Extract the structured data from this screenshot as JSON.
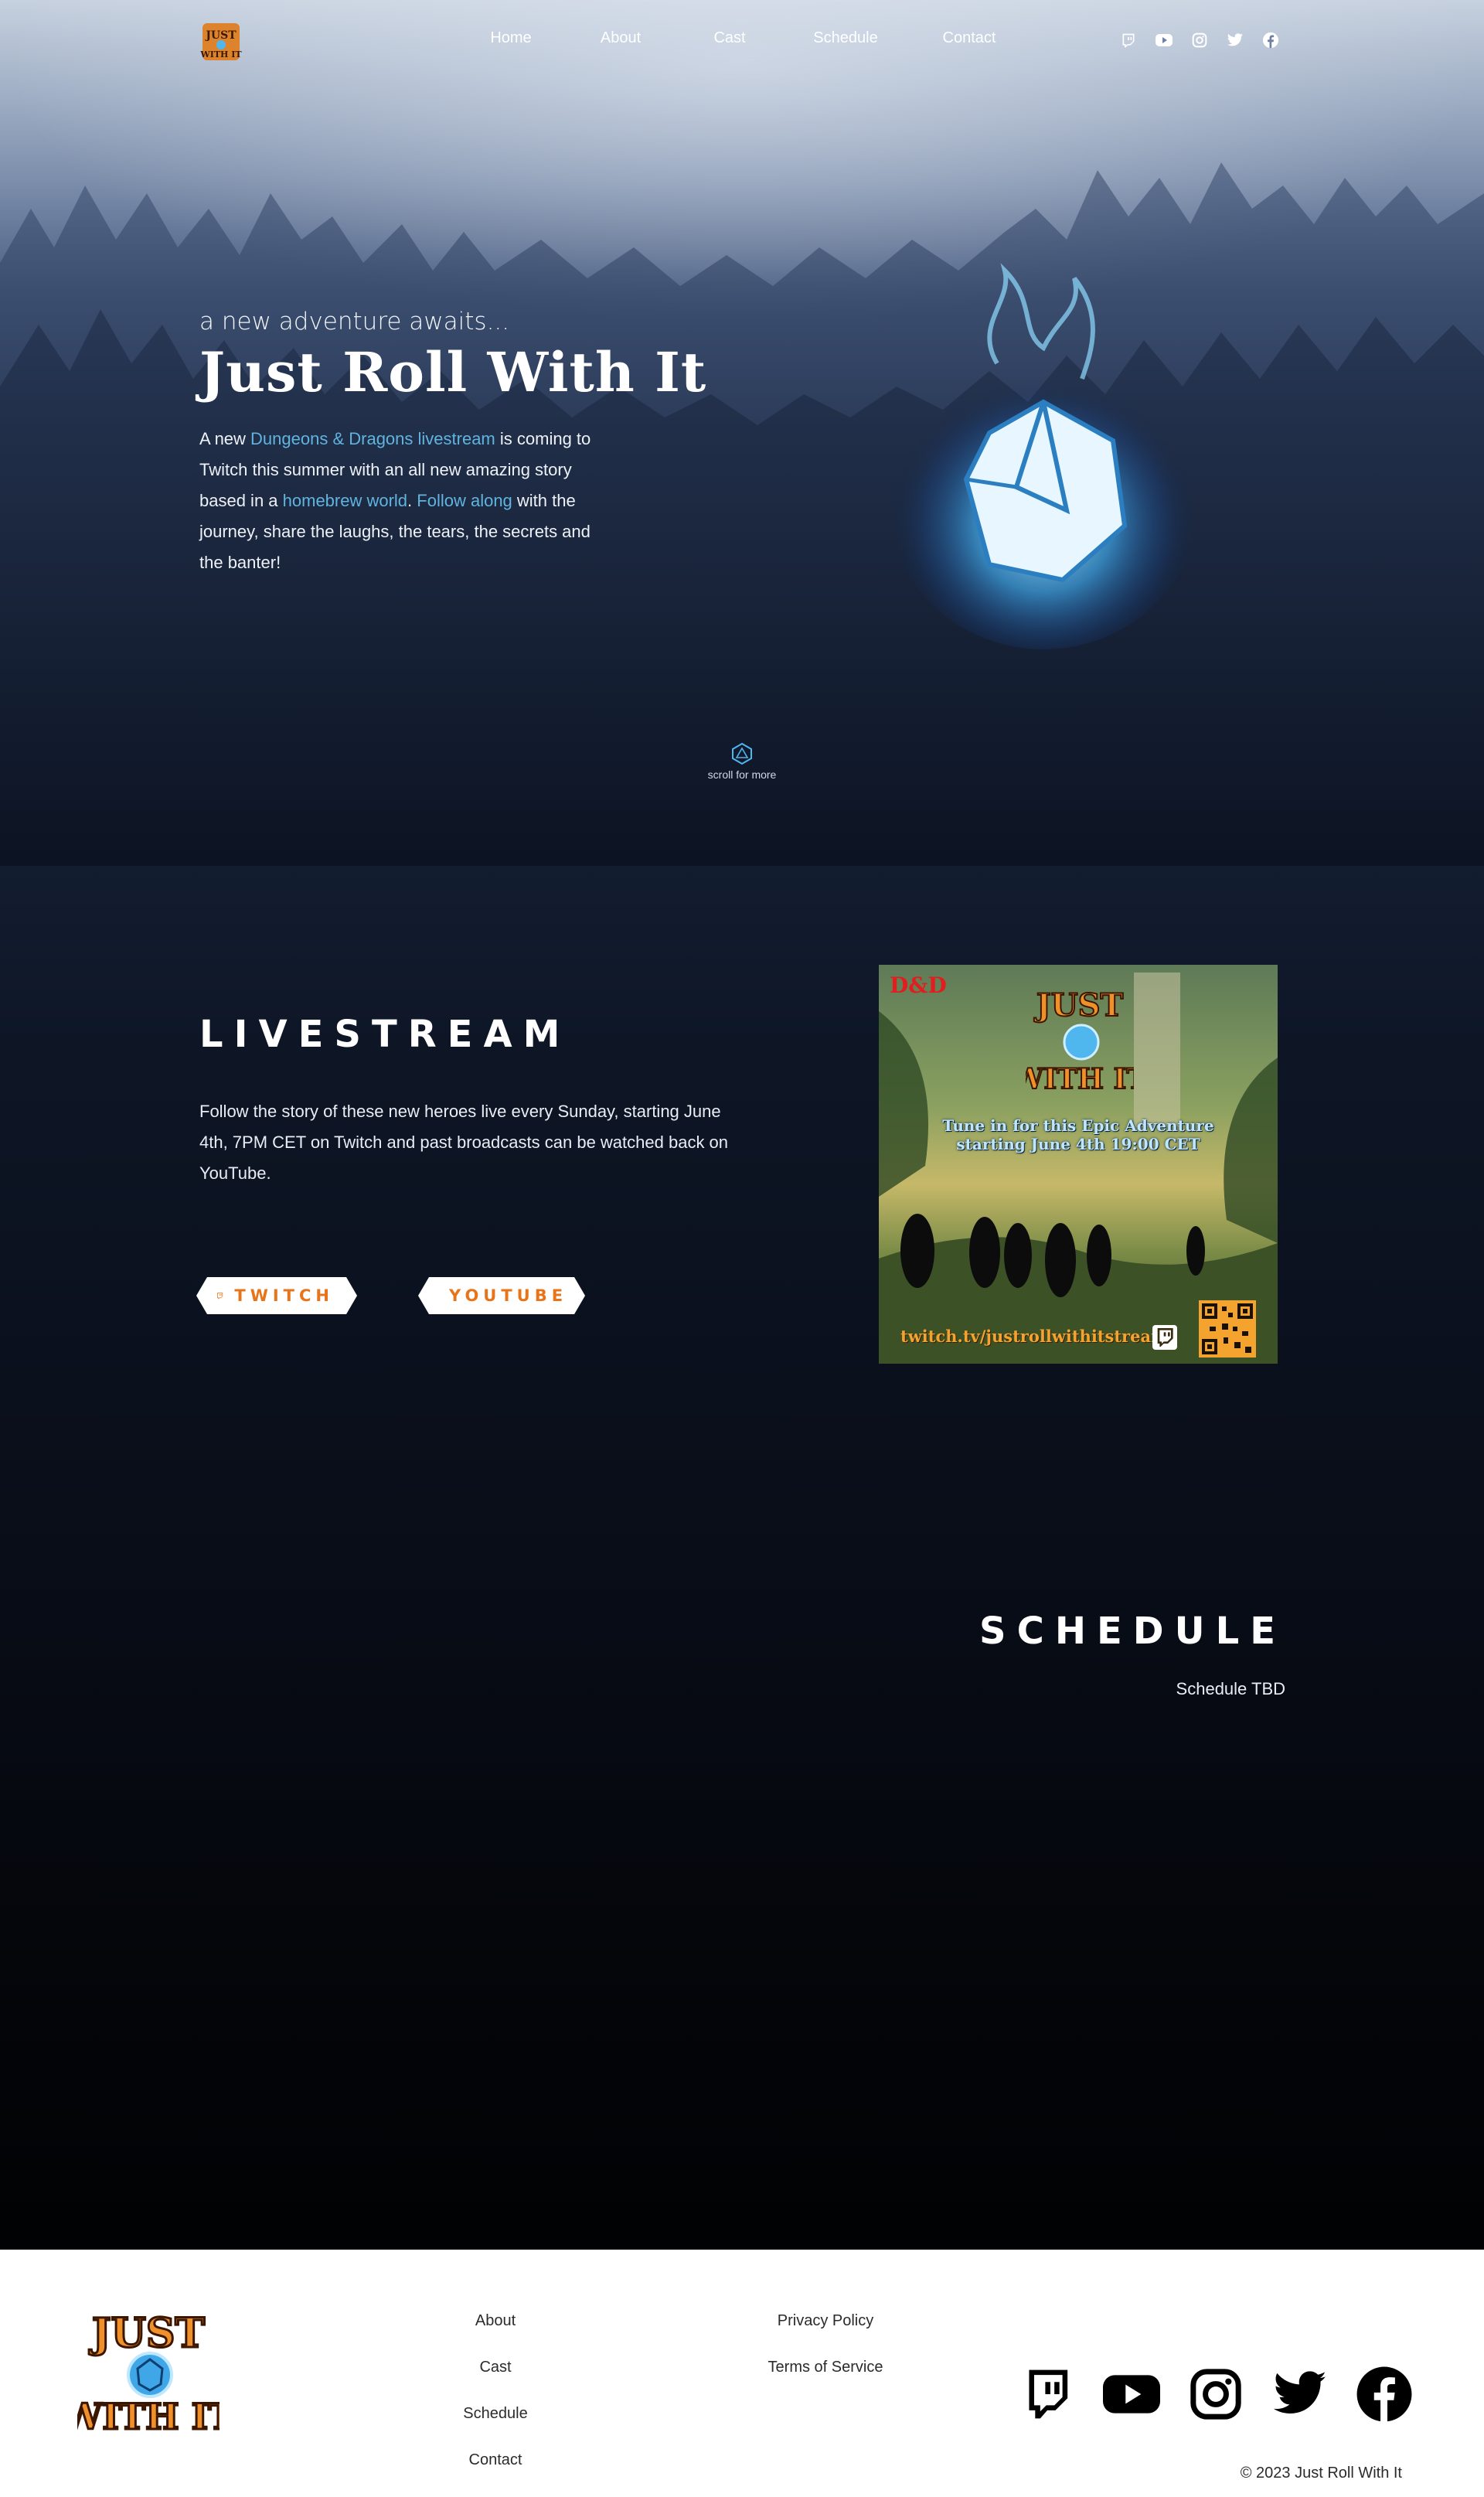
{
  "nav": {
    "logo_alt": "Just Roll With It",
    "links": [
      "Home",
      "About",
      "Cast",
      "Schedule",
      "Contact"
    ],
    "social_icons": [
      "twitch-icon",
      "youtube-icon",
      "instagram-icon",
      "twitter-icon",
      "facebook-icon"
    ]
  },
  "hero": {
    "tagline": "a new adventure awaits...",
    "title": "Just Roll With It",
    "text_parts": {
      "p1": "A new ",
      "link1": "Dungeons & Dragons livestream",
      "p2": " is coming to Twitch this summer with an all new amazing story based in a ",
      "link2": "homebrew world",
      "p3": ". ",
      "link3": "Follow along",
      "p4": " with the journey, share the laughs, the tears, the secrets and the banter!"
    },
    "scroll_label": "scroll for more"
  },
  "livestream": {
    "title": "LIVESTREAM",
    "text": "Follow the story of these new heroes live every Sunday, starting June 4th, 7PM CET on Twitch and past broadcasts can be watched back on YouTube.",
    "twitch_label": "TWITCH",
    "youtube_label": "YOUTUBE",
    "poster": {
      "brand": "D&D",
      "tune_line1": "Tune in for this Epic Adventure",
      "tune_line2": "starting June 4th 19:00 CET",
      "url": "twitch.tv/justrollwithitstream"
    }
  },
  "schedule": {
    "title": "SCHEDULE",
    "text": "Schedule TBD"
  },
  "footer": {
    "col1": [
      "About",
      "Cast",
      "Schedule",
      "Contact"
    ],
    "col2": [
      "Privacy Policy",
      "Terms of Service"
    ],
    "copyright": "© 2023 Just Roll With It"
  },
  "colors": {
    "accent_link": "#5fb4e0",
    "button_text": "#e8741a",
    "footer_bg": "#ffffff"
  }
}
